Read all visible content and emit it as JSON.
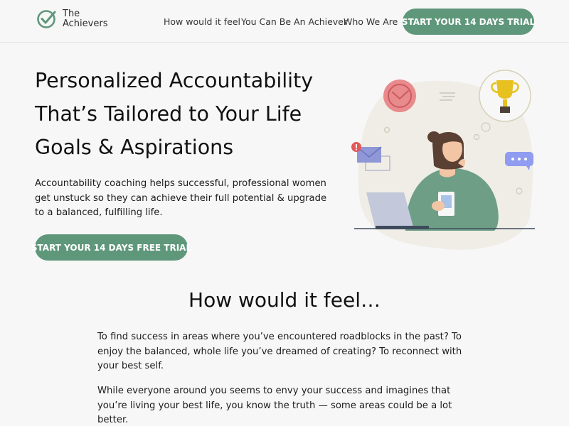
{
  "header": {
    "logo_line1": "The",
    "logo_line2": "Achievers",
    "nav": [
      "How would it feel",
      "You Can Be An Achiever",
      "Who We Are"
    ],
    "cta": "START YOUR 14 DAYS TRIAL"
  },
  "hero": {
    "title_lines": [
      "Personalized Accountability",
      "That’s Tailored to Your Life",
      "Goals & Aspirations"
    ],
    "text": "Accountability coaching helps successful, professional women get unstuck so they can achieve their full potential & upgrade to a balanced, fulfilling life.",
    "cta": "START YOUR 14 DAYS FREE TRIAL"
  },
  "section": {
    "title": "How would it feel…",
    "paragraphs": [
      "To find success in areas where you’ve encountered roadblocks in the past? To enjoy the balanced, whole life you’ve dreamed of creating? To reconnect with your best self.",
      "While everyone around you seems to envy your success and imagines that you’re living your best life, you know the truth — some areas could be a lot better."
    ]
  },
  "colors": {
    "accent": "#5f977b",
    "background": "#f7f7f7",
    "blob": "#efede6",
    "sweater": "#6e9e86"
  },
  "icons": [
    "checkmark-logo-icon",
    "clock-icon",
    "trophy-icon",
    "envelope-icon",
    "chat-bubble-icon",
    "laptop-icon"
  ]
}
